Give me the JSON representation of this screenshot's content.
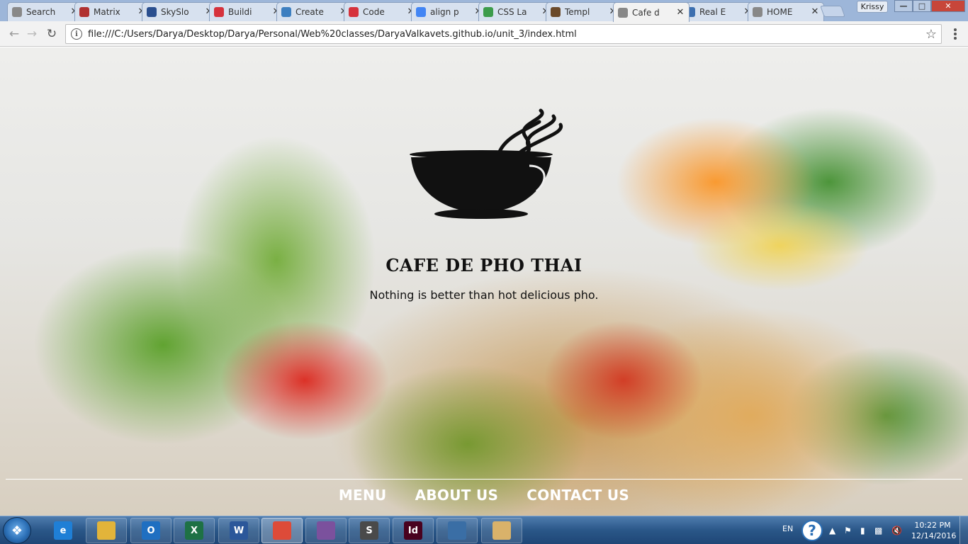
{
  "browser": {
    "tabs": [
      {
        "title": "Search",
        "icon": "page-icon",
        "color": "#888888"
      },
      {
        "title": "Matrix",
        "icon": "matrix-icon",
        "color": "#b03030"
      },
      {
        "title": "SkySlo",
        "icon": "skyslope-icon",
        "color": "#2a4f8f"
      },
      {
        "title": "Buildi",
        "icon": "ga-icon",
        "color": "#d6323c"
      },
      {
        "title": "Create",
        "icon": "skyslope-icon",
        "color": "#3d7fc0"
      },
      {
        "title": "Code",
        "icon": "ga-icon",
        "color": "#d6323c"
      },
      {
        "title": "align p",
        "icon": "google-icon",
        "color": "#4285f4"
      },
      {
        "title": "CSS La",
        "icon": "css-icon",
        "color": "#3d9c4b"
      },
      {
        "title": "Templ",
        "icon": "template-icon",
        "color": "#6b4a2a"
      },
      {
        "title": "Cafe d",
        "icon": "page-icon",
        "color": "#888888",
        "active": true
      },
      {
        "title": "Real E",
        "icon": "real-estate-icon",
        "color": "#3c6fb0"
      },
      {
        "title": "HOME",
        "icon": "page-icon",
        "color": "#888888"
      }
    ],
    "profile_name": "Krissy",
    "url": "file:///C:/Users/Darya/Desktop/Darya/Personal/Web%20classes/DaryaValkavets.github.io/unit_3/index.html"
  },
  "page": {
    "title": "CAFE DE PHO THAI",
    "tagline": "Nothing is better than hot delicious pho.",
    "nav": [
      {
        "label": "MENU"
      },
      {
        "label": "ABOUT US"
      },
      {
        "label": "CONTACT US"
      }
    ]
  },
  "taskbar": {
    "apps": [
      {
        "name": "internet-explorer-icon",
        "color": "#1f7fd6",
        "glyph": "e"
      },
      {
        "name": "file-explorer-icon",
        "color": "#e2b43a",
        "glyph": ""
      },
      {
        "name": "outlook-icon",
        "color": "#1f6fc1",
        "glyph": "O"
      },
      {
        "name": "excel-icon",
        "color": "#1e7145",
        "glyph": "X"
      },
      {
        "name": "word-icon",
        "color": "#2b579a",
        "glyph": "W"
      },
      {
        "name": "chrome-icon",
        "color": "#dd4b39",
        "glyph": ""
      },
      {
        "name": "viber-icon",
        "color": "#7b519d",
        "glyph": ""
      },
      {
        "name": "sublime-text-icon",
        "color": "#4a4a4a",
        "glyph": "S"
      },
      {
        "name": "indesign-icon",
        "color": "#49021f",
        "glyph": "Id"
      },
      {
        "name": "remote-desktop-icon",
        "color": "#3a6ea5",
        "glyph": ""
      },
      {
        "name": "paint-icon",
        "color": "#d9b26a",
        "glyph": ""
      }
    ],
    "language": "EN",
    "time": "10:22 PM",
    "date": "12/14/2016"
  }
}
